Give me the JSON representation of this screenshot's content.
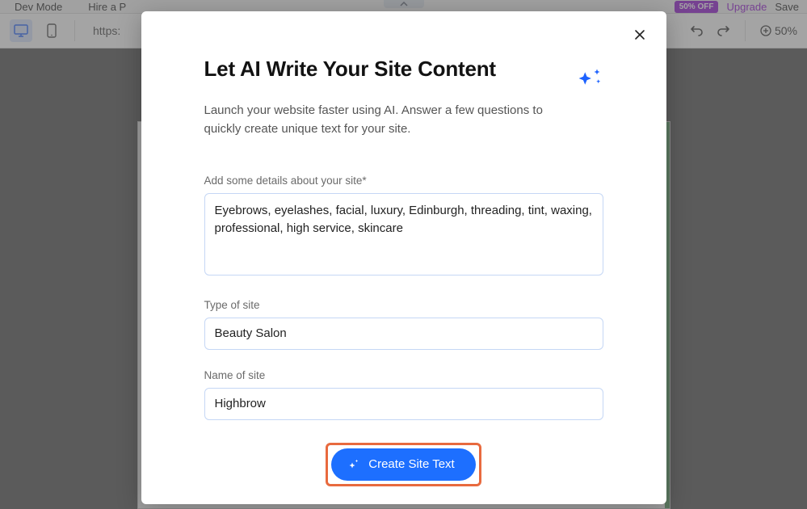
{
  "toolbar": {
    "dev_mode": "Dev Mode",
    "hire_partner": "Hire a P",
    "badge": "50% OFF",
    "upgrade": "Upgrade",
    "save": "Save"
  },
  "secondbar": {
    "url_prefix": "https:",
    "zoom": "50%"
  },
  "modal": {
    "title": "Let AI Write Your Site Content",
    "description": "Launch your website faster using AI. Answer a few questions to quickly create unique text for your site.",
    "details_label": "Add some details about your site*",
    "details_value": "Eyebrows, eyelashes, facial, luxury, Edinburgh, threading, tint, waxing, professional, high service, skincare",
    "type_label": "Type of site",
    "type_value": "Beauty Salon",
    "name_label": "Name of site",
    "name_value": "Highbrow",
    "cta": "Create Site Text"
  }
}
